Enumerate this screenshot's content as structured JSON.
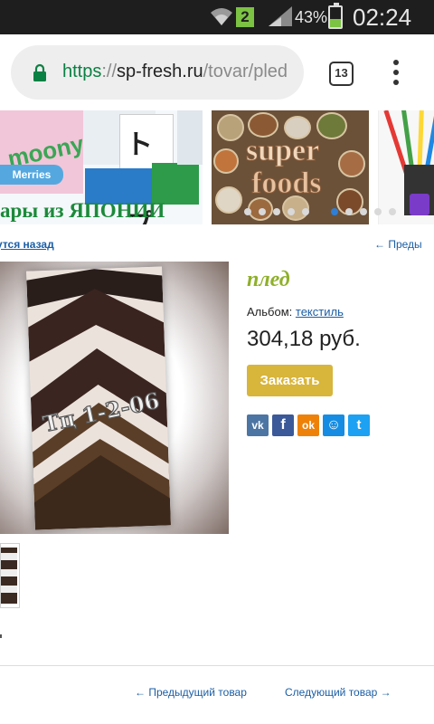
{
  "status_bar": {
    "battery_percent": "43%",
    "time": "02:24",
    "sim_indicator": "2",
    "battery_level": 0.43,
    "icons": [
      "wifi-icon",
      "signal-icon",
      "battery-icon"
    ]
  },
  "browser": {
    "url_scheme": "https",
    "url_separator": "://",
    "url_host": "sp-fresh.ru",
    "url_path": "/tovar/pled",
    "tab_count": "13",
    "icons": [
      "lock-icon",
      "menu-dots-icon"
    ],
    "scheme_color": "#0b8043"
  },
  "banner": {
    "slide1_caption": "ары из ЯПОНИИ",
    "slide1_logo_moony": "moony",
    "slide1_logo_merries": "Merries",
    "slide1_box_text": "トップ",
    "slide2_word1": "super",
    "slide2_word2": "foods",
    "dot_count": 8,
    "active_dot": 5
  },
  "nav": {
    "back_label": "утся назад",
    "prev_top_label": "←   Преды"
  },
  "product": {
    "title": "плед",
    "album_label": "Альбом:",
    "album_link": "текстиль",
    "price": "304,18 руб.",
    "order_button": "Заказать",
    "image_stamp": "Тц 1-2-06",
    "title_color": "#8fb02a",
    "button_color": "#d8b53b"
  },
  "social": [
    {
      "name": "vk-icon",
      "label": "vk",
      "color": "#4c75a3"
    },
    {
      "name": "facebook-icon",
      "label": "f",
      "color": "#3b5998"
    },
    {
      "name": "odnoklassniki-icon",
      "label": "ok",
      "color": "#ee8208"
    },
    {
      "name": "moimir-icon",
      "label": "☺",
      "color": "#168de2"
    },
    {
      "name": "twitter-icon",
      "label": "t",
      "color": "#1da1f2"
    }
  ],
  "footer_nav": {
    "prev_label": "←  Предыдущий товар",
    "next_label": "Следующий товар  →"
  },
  "link_color": "#1b5ea5"
}
